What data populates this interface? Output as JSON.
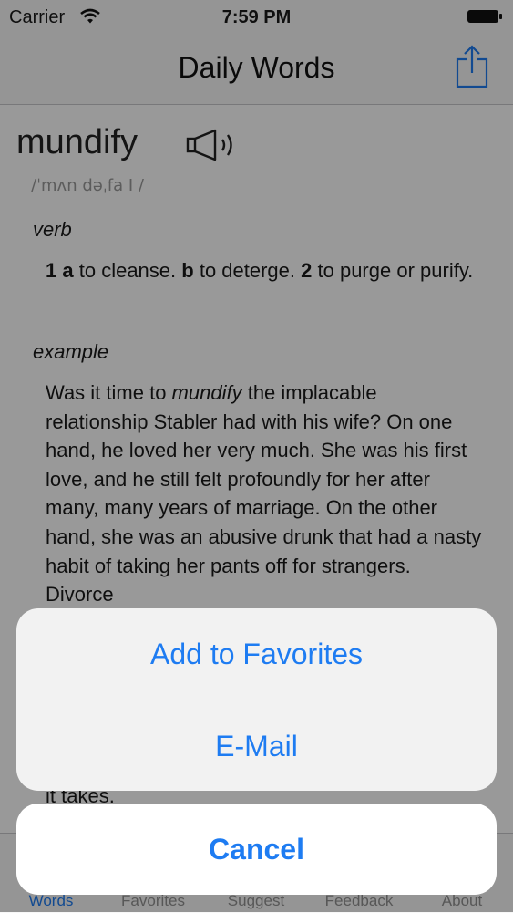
{
  "status": {
    "carrier": "Carrier",
    "time": "7:59 PM"
  },
  "nav": {
    "title": "Daily Words"
  },
  "entry": {
    "word": "mundify",
    "pronunciation": "/ˈmʌn dəˌfa I /",
    "part_of_speech": "verb",
    "definition": {
      "n1": "1",
      "a": "a",
      "a_text": " to cleanse. ",
      "b": "b",
      "b_text": " to deterge. ",
      "n2": "2",
      "n2_text": " to purge or purify."
    },
    "example_label": "example",
    "example": {
      "before": "Was it time to ",
      "em": "mundify",
      "after": " the implacable relationship Stabler had with his wife? On one hand, he loved her very much. She was his first love, and he still felt profoundly for her after many, many years of marriage. On the other hand, she was an abusive drunk that had a nasty habit of taking her pants off for strangers. Divorce",
      "tail": "it takes."
    }
  },
  "tabs": [
    {
      "label": "Words",
      "active": true
    },
    {
      "label": "Favorites",
      "active": false
    },
    {
      "label": "Suggest",
      "active": false
    },
    {
      "label": "Feedback",
      "active": false
    },
    {
      "label": "About",
      "active": false
    }
  ],
  "action_sheet": {
    "add_favorites": "Add to Favorites",
    "email": "E-Mail",
    "cancel": "Cancel"
  },
  "colors": {
    "accent": "#1e7cf2",
    "dim_overlay": "rgba(0,0,0,0.4)"
  }
}
